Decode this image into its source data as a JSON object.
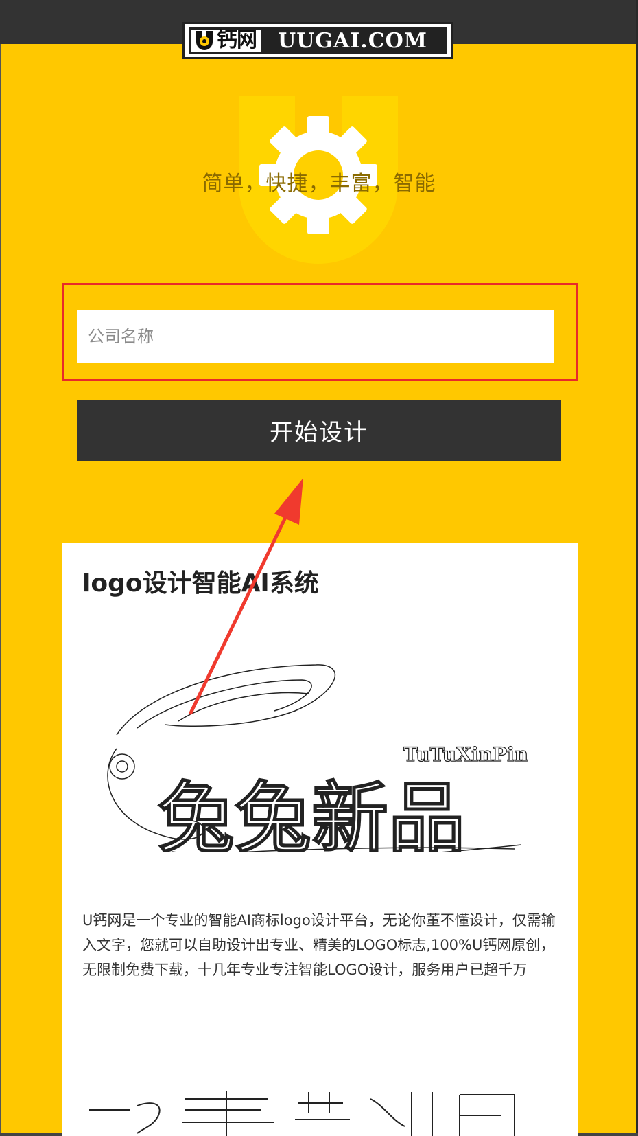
{
  "header": {
    "logo_cn": "钙网",
    "logo_en": "UUGAI.COM",
    "logo_badge_letter": "U"
  },
  "hero": {
    "tagline": "简单，快捷，丰富，智能"
  },
  "form": {
    "company_placeholder": "公司名称",
    "company_value": "",
    "start_button_label": "开始设计"
  },
  "card": {
    "title": "logo设计智能AI系统",
    "sample_logo_cn": "兔兔新品",
    "sample_logo_en": "TuTuXinPin",
    "description": "U钙网是一个专业的智能AI商标logo设计平台，无论你董不懂设计，仅需输入文字，您就可以自助设计出专业、精美的LOGO标志,100%U钙网原创，无限制免费下载，十几年专业专注智能LOGO设计，服务用户已超千万"
  },
  "colors": {
    "brand_yellow": "#FFC800",
    "dark": "#333333",
    "highlight_red": "#E82A2A",
    "annotation_arrow": "#F03A2E"
  },
  "icons": {
    "hero": "gear-icon",
    "header_badge": "gear-icon",
    "annotation": "arrow-annotation"
  }
}
